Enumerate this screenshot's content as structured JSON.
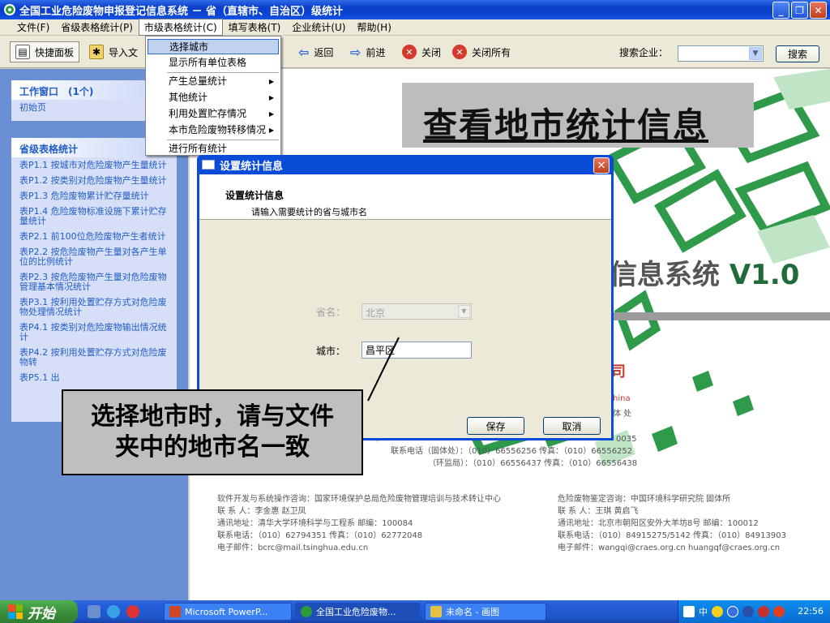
{
  "window": {
    "title": "全国工业危险废物申报登记信息系统 － 省（直辖市、自治区）级统计"
  },
  "menubar": {
    "items": [
      "文件(F)",
      "省级表格统计(P)",
      "市级表格统计(C)",
      "填写表格(T)",
      "企业统计(U)",
      "帮助(H)"
    ]
  },
  "toolbar": {
    "quick_panel": "快捷面板",
    "import": "导入文",
    "back": "返回",
    "forward": "前进",
    "close": "关闭",
    "close_all": "关闭所有",
    "search_label": "搜索企业：",
    "search_value": "",
    "search_button": "搜索"
  },
  "dropdown": {
    "items": [
      "选择城市",
      "显示所有单位表格",
      "产生总量统计",
      "其他统计",
      "利用处置贮存情况",
      "本市危险废物转移情况",
      "进行所有统计"
    ]
  },
  "sidebar": {
    "work_window": {
      "title": "工作窗口　(1个)",
      "items": [
        "初始页"
      ]
    },
    "province_stats": {
      "title": "省级表格统计",
      "items": [
        "表P1.1 按城市对危险废物产生量统计",
        "表P1.2 按类别对危险废物产生量统计",
        "表P1.3 危险废物累计贮存量统计",
        "表P1.4 危险废物标准设施下累计贮存量统计",
        "表P2.1 前100位危险废物产生者统计",
        "表P2.2 按危险废物产生量对各产生单位的比例统计",
        "表P2.3 按危险废物产生量对危险废物管理基本情况统计",
        "表P3.1 按利用处置贮存方式对危险废物处理情况统计",
        "表P4.1 按类别对危险废物输出情况统计",
        "表P4.2 按利用处置贮存方式对危险废物转",
        "表P5.1 出"
      ]
    }
  },
  "content": {
    "big_title": "查看地市统计信息",
    "system_name": "信息系统",
    "version": "V1.0",
    "contact_left": [
      "软件开发与系统操作咨询：国家环境保护总局危险废物管理培训与技术转让中心",
      "联 系 人：李金惠  赵卫凤",
      "通讯地址：清华大学环境科学与工程系    邮编：100084",
      "联系电话：（010）62794351    传真：（010）62772048",
      "电子邮件：bcrc@mail.tsinghua.edu.cn"
    ],
    "contact_right": [
      "危险废物鉴定咨询：中国环境科学研究院  固体所",
      "联 系 人：王琪  黄启飞",
      "通讯地址：北京市朝阳区安外大羊坊8号    邮编：100012",
      "联系电话：（010）84915275/5142   传真：（010）84913903",
      "电子邮件：wangqi@craes.org.cn   huangqf@craes.org.cn"
    ],
    "contact_center": [
      "0035",
      "联系电话（固体处）：（010）66556256   传真：（010）66556252",
      "（环监局）：（010）66556437   传真：（010）66556438"
    ],
    "partial_red": "司",
    "partial_small": "hina",
    "partial_text": "体 处"
  },
  "dialog": {
    "title": "设置统计信息",
    "heading": "设置统计信息",
    "subheading": "请输入需要统计的省与城市名",
    "province_label": "省名：",
    "province_value": "北京",
    "city_label": "城市：",
    "city_value": "昌平区",
    "save": "保存",
    "cancel": "取消"
  },
  "callout": {
    "line1": "选择地市时，请与文件",
    "line2": "夹中的地市名一致"
  },
  "taskbar": {
    "start": "开始",
    "tasks": [
      "Microsoft PowerP...",
      "全国工业危险废物...",
      "未命名 - 画图"
    ],
    "tray_text": "中",
    "clock": "22:56"
  }
}
